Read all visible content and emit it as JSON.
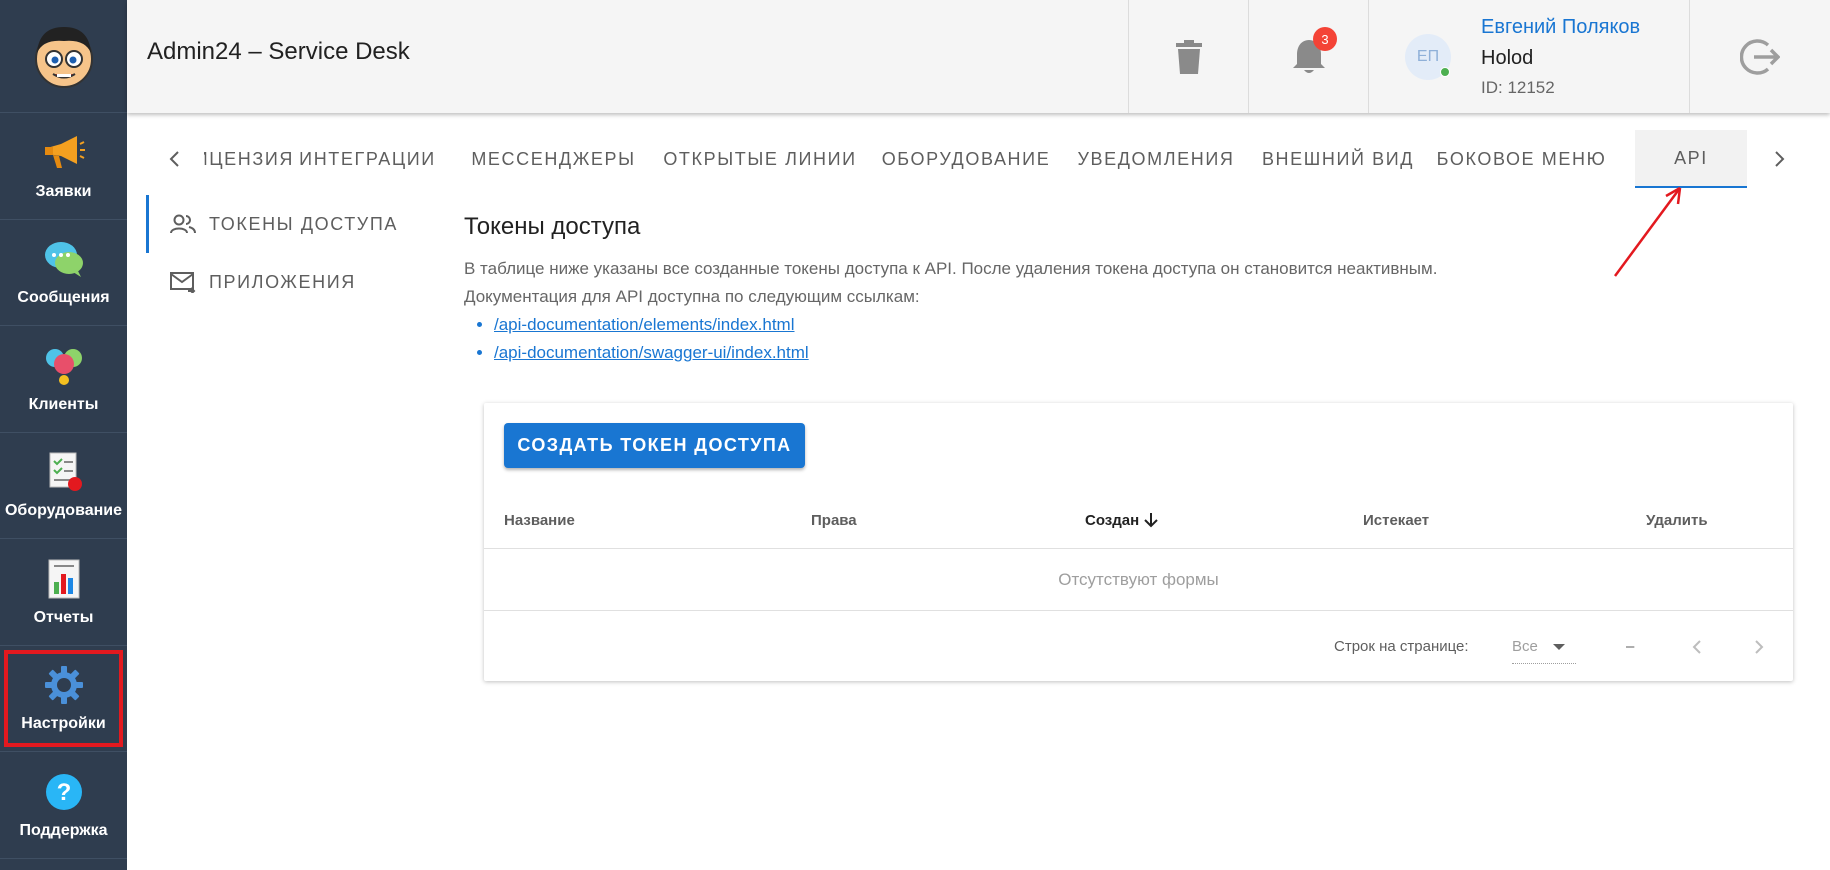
{
  "sidebar": {
    "items": [
      {
        "label": "Заявки"
      },
      {
        "label": "Сообщения"
      },
      {
        "label": "Клиенты"
      },
      {
        "label": "Оборудование"
      },
      {
        "label": "Отчеты"
      },
      {
        "label": "Настройки",
        "selected": true
      },
      {
        "label": "Поддержка"
      }
    ]
  },
  "header": {
    "title": "Admin24 – Service Desk",
    "notifications_count": "3",
    "user": {
      "initials": "ЕП",
      "name": "Евгений Поляков",
      "org": "Holod",
      "id": "ID: 12152"
    }
  },
  "tabs": {
    "items": [
      {
        "label": "ЛИЦЕНЗИЯ"
      },
      {
        "label": "ИНТЕГРАЦИИ"
      },
      {
        "label": "МЕССЕНДЖЕРЫ"
      },
      {
        "label": "ОТКРЫТЫЕ ЛИНИИ"
      },
      {
        "label": "ОБОРУДОВАНИЕ"
      },
      {
        "label": "УВЕДОМЛЕНИЯ"
      },
      {
        "label": "ВНЕШНИЙ ВИД"
      },
      {
        "label": "БОКОВОЕ МЕНЮ"
      },
      {
        "label": "API",
        "active": true
      }
    ]
  },
  "subnav": {
    "items": [
      {
        "label": "ТОКЕНЫ ДОСТУПА",
        "active": true
      },
      {
        "label": "ПРИЛОЖЕНИЯ"
      }
    ]
  },
  "content": {
    "title": "Токены доступа",
    "description": "В таблице ниже указаны все созданные токены доступа к API. После удаления токена доступа он становится неактивным.",
    "docs_intro": "Документация для API доступна по следующим ссылкам:",
    "links": [
      "/api-documentation/elements/index.html",
      "/api-documentation/swagger-ui/index.html"
    ]
  },
  "table": {
    "create_button": "СОЗДАТЬ ТОКЕН ДОСТУПА",
    "columns": [
      "Название",
      "Права",
      "Создан",
      "Истекает",
      "Удалить"
    ],
    "sorted_column": "Создан",
    "empty_text": "Отсутствуют формы",
    "rows_per_page_label": "Строк на странице:",
    "rows_per_page_value": "Все",
    "range": "–"
  },
  "colors": {
    "sidebar_bg": "#2f3d4f",
    "accent": "#1976d2",
    "highlight": "#e3191f"
  }
}
